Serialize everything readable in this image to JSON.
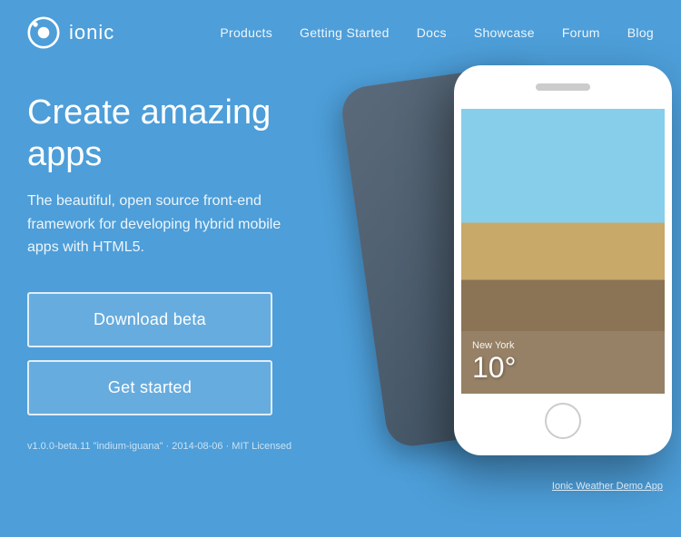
{
  "header": {
    "logo_text": "ionic",
    "nav_items": [
      {
        "label": "Products",
        "href": "#"
      },
      {
        "label": "Getting Started",
        "href": "#"
      },
      {
        "label": "Docs",
        "href": "#"
      },
      {
        "label": "Showcase",
        "href": "#"
      },
      {
        "label": "Forum",
        "href": "#"
      },
      {
        "label": "Blog",
        "href": "#"
      }
    ]
  },
  "hero": {
    "title": "Create amazing apps",
    "subtitle": "The beautiful, open source front-end framework for developing hybrid mobile apps with HTML5.",
    "btn_download": "Download beta",
    "btn_started": "Get started",
    "version_text": "v1.0.0-beta.11 \"indium-iguana\" · 2014-08-06 · MIT Licensed",
    "weather_link": "Ionic Weather Demo App"
  },
  "phone": {
    "temperature": "10°",
    "city": "New York"
  }
}
